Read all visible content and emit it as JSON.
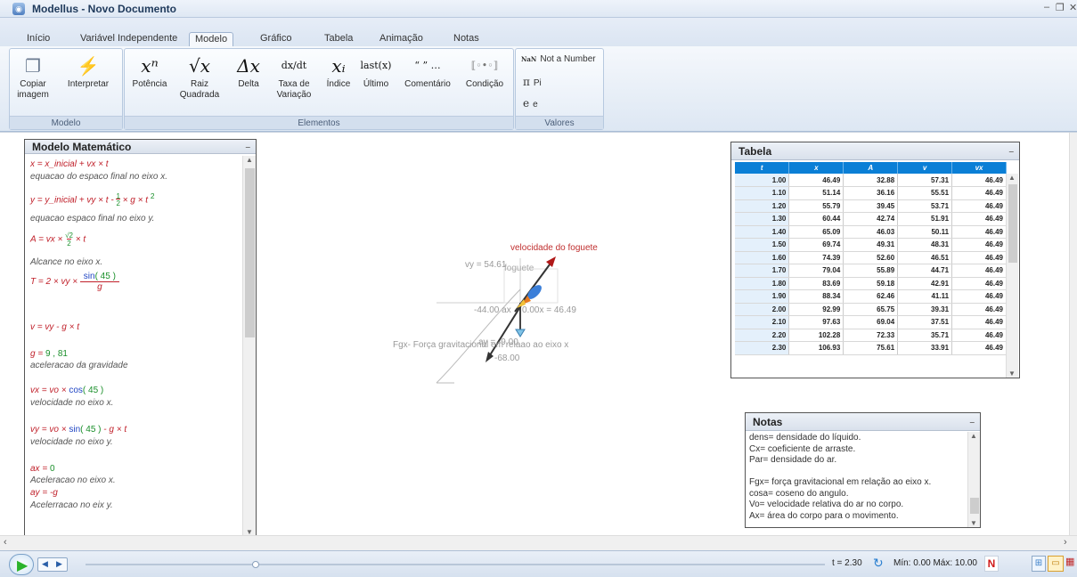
{
  "window": {
    "title": "Modellus - Novo Documento",
    "app_icon": "modellus-icon",
    "controls": [
      "minimize-icon",
      "restore-icon",
      "close-icon"
    ]
  },
  "tabs": [
    {
      "label": "Início"
    },
    {
      "label": "Variável Independente"
    },
    {
      "label": "Modelo",
      "active": true
    },
    {
      "label": "Gráfico"
    },
    {
      "label": "Tabela"
    },
    {
      "label": "Animação"
    },
    {
      "label": "Notas"
    }
  ],
  "ribbon": {
    "modelo_group": {
      "label": "Modelo",
      "buttons": [
        {
          "label": "Copiar imagem",
          "icon": "copy-image-icon"
        },
        {
          "label": "Interpretar",
          "icon": "interpret-icon"
        }
      ]
    },
    "elementos_group": {
      "label": "Elementos",
      "buttons": [
        {
          "label": "Potência",
          "glyph": "xⁿ"
        },
        {
          "label": "Raiz Quadrada",
          "glyph": "√x"
        },
        {
          "label": "Delta",
          "glyph": "Δx"
        },
        {
          "label": "Taxa de Variação",
          "glyph": "dx/dt"
        },
        {
          "label": "Índice",
          "glyph": "xᵢ"
        },
        {
          "label": "Último",
          "glyph": "last(x)"
        },
        {
          "label": "Comentário",
          "glyph": "“ ” …"
        },
        {
          "label": "Condição",
          "glyph": "condition-icon"
        }
      ]
    },
    "valores_group": {
      "label": "Valores",
      "items": [
        {
          "symbol": "NaN",
          "label": "Not a Number"
        },
        {
          "symbol": "π",
          "label": "Pi"
        },
        {
          "symbol": "e",
          "label": "e"
        }
      ]
    }
  },
  "model_panel": {
    "title": "Modelo Matemático",
    "lines": [
      {
        "kind": "eq",
        "text": "x = x_inicial + vx × t"
      },
      {
        "kind": "comment",
        "text": "equacao do espaco final no eixo x."
      },
      {
        "kind": "eq",
        "text": "y = y_inicial + vy × t - ½ × g × t²"
      },
      {
        "kind": "comment",
        "text": "equacao espaco final no eixo y."
      },
      {
        "kind": "eq",
        "text": "A = vx × √2 / 2 × t"
      },
      {
        "kind": "comment",
        "text": "Alcance no eixo x."
      },
      {
        "kind": "eq",
        "text": "T = 2 × vy × sin( 45 ) / g"
      },
      {
        "kind": "eq",
        "text": "v = vy - g × t"
      },
      {
        "kind": "eq",
        "text": "g = 9 , 81"
      },
      {
        "kind": "comment",
        "text": "aceleracao da gravidade"
      },
      {
        "kind": "eq",
        "text": "vx = vo × cos( 45 )"
      },
      {
        "kind": "comment",
        "text": "velocidade no eixo x."
      },
      {
        "kind": "eq",
        "text": "vy = vo × sin( 45 ) - g × t"
      },
      {
        "kind": "comment",
        "text": "velocidade no eixo y."
      },
      {
        "kind": "eq",
        "text": "ax = 0"
      },
      {
        "kind": "comment",
        "text": "Aceleracao no eixo x."
      },
      {
        "kind": "eq",
        "text": "ay = -g"
      },
      {
        "kind": "comment",
        "text": "Acelerracao no eix y."
      }
    ]
  },
  "animation": {
    "velocity_label": "velocidade do foguete",
    "vy_label": "vy = 54.61",
    "rocket_label": "foguete",
    "ax_label": "-44.00 ax",
    "vx_label": "0.00x = 46.49",
    "force_label": "Fgx- Força gravitacional em relaao ao eixo x",
    "ay_label": "ay = -9.00",
    "neg68_label": "-68.00"
  },
  "table_panel": {
    "title": "Tabela",
    "headers": [
      "t",
      "x",
      "A",
      "v",
      "vx"
    ],
    "rows": [
      [
        "1.00",
        "46.49",
        "32.88",
        "57.31",
        "46.49"
      ],
      [
        "1.10",
        "51.14",
        "36.16",
        "55.51",
        "46.49"
      ],
      [
        "1.20",
        "55.79",
        "39.45",
        "53.71",
        "46.49"
      ],
      [
        "1.30",
        "60.44",
        "42.74",
        "51.91",
        "46.49"
      ],
      [
        "1.40",
        "65.09",
        "46.03",
        "50.11",
        "46.49"
      ],
      [
        "1.50",
        "69.74",
        "49.31",
        "48.31",
        "46.49"
      ],
      [
        "1.60",
        "74.39",
        "52.60",
        "46.51",
        "46.49"
      ],
      [
        "1.70",
        "79.04",
        "55.89",
        "44.71",
        "46.49"
      ],
      [
        "1.80",
        "83.69",
        "59.18",
        "42.91",
        "46.49"
      ],
      [
        "1.90",
        "88.34",
        "62.46",
        "41.11",
        "46.49"
      ],
      [
        "2.00",
        "92.99",
        "65.75",
        "39.31",
        "46.49"
      ],
      [
        "2.10",
        "97.63",
        "69.04",
        "37.51",
        "46.49"
      ],
      [
        "2.20",
        "102.28",
        "72.33",
        "35.71",
        "46.49"
      ],
      [
        "2.30",
        "106.93",
        "75.61",
        "33.91",
        "46.49"
      ]
    ]
  },
  "notes_panel": {
    "title": "Notas",
    "lines": [
      "dens= densidade do líquido.",
      "Cx= coeficiente de arraste.",
      "Par= densidade do ar.",
      "",
      "Fgx= força gravitacional em relação ao eixo x.",
      "cosa= coseno do angulo.",
      "Vo= velocidade relativa do ar no corpo.",
      "Ax= área do corpo para o movimento."
    ]
  },
  "bottom": {
    "time_label": "t = 2.30",
    "range_label": "Mín: 0.00 Máx: 10.00",
    "slider_progress": 0.23
  }
}
